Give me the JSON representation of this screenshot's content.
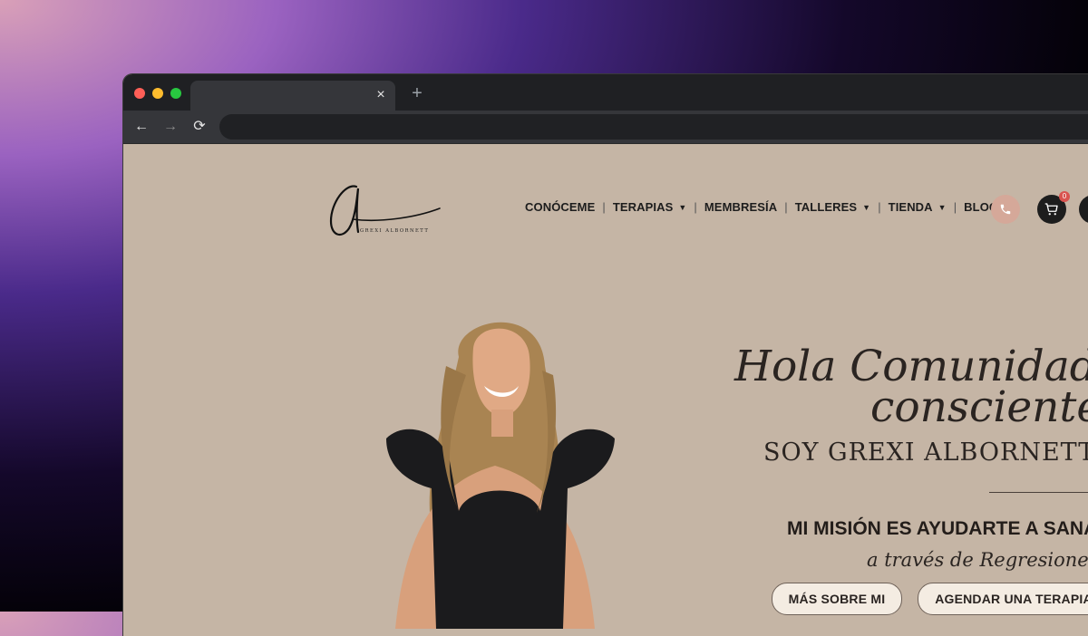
{
  "browser": {
    "tab_close": "×",
    "new_tab": "+",
    "back": "←",
    "forward": "→",
    "reload": "⟳"
  },
  "site": {
    "logo_initial": "G",
    "logo_name": "GREXI ALBORNETT",
    "nav": [
      {
        "label": "CONÓCEME",
        "has_dropdown": false
      },
      {
        "label": "TERAPIAS",
        "has_dropdown": true
      },
      {
        "label": "MEMBRESÍA",
        "has_dropdown": false
      },
      {
        "label": "TALLERES",
        "has_dropdown": true
      },
      {
        "label": "TIENDA",
        "has_dropdown": true
      },
      {
        "label": "BLOG",
        "has_dropdown": true
      }
    ],
    "separator": "|",
    "chevron": "⌄",
    "cart_count": "0",
    "icons": {
      "phone": "phone-icon",
      "cart": "cart-icon",
      "user": "user-icon"
    }
  },
  "hero": {
    "title_line1": "Hola Comunidad",
    "title_line2": "consciente",
    "subtitle": "SOY GREXI ALBORNETT",
    "mission": "MI MISIÓN ES AYUDARTE A SANAR",
    "through": "a través de Regresiones",
    "btn_more": "MÁS SOBRE MI",
    "btn_schedule": "AGENDAR UNA TERAPIA"
  },
  "colors": {
    "page_bg": "#c5b5a5",
    "phone_btn": "#d5a899",
    "dark": "#1d1d1d",
    "button_bg": "#f4ece2"
  }
}
